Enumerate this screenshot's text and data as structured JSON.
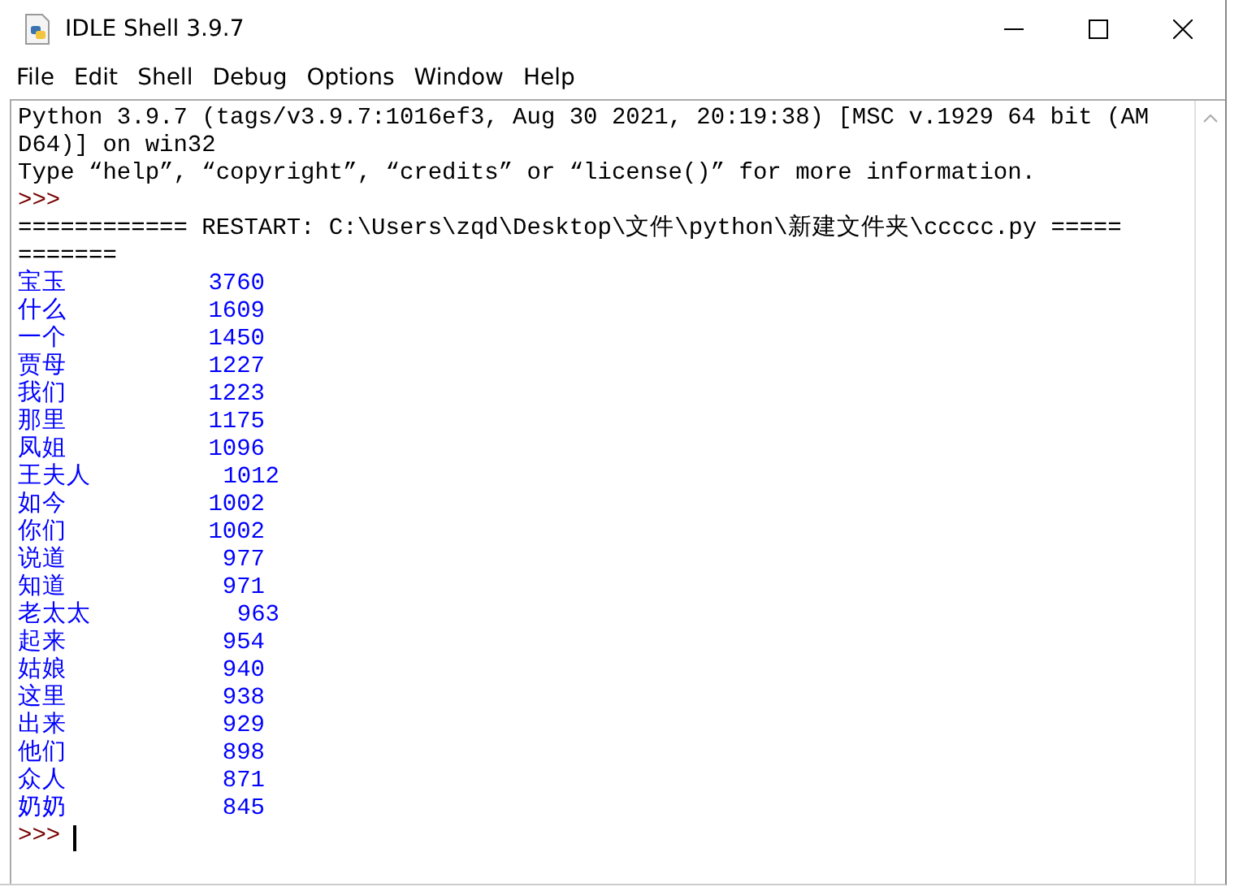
{
  "window": {
    "title": "IDLE Shell 3.9.7"
  },
  "menu": [
    "File",
    "Edit",
    "Shell",
    "Debug",
    "Options",
    "Window",
    "Help"
  ],
  "shell": {
    "lines": [
      {
        "kind": "text",
        "text": "Python 3.9.7 (tags/v3.9.7:1016ef3, Aug 30 2021, 20:19:38) [MSC v.1929 64 bit (AM"
      },
      {
        "kind": "text",
        "text": "D64)] on win32"
      },
      {
        "kind": "text",
        "text": "Type “help”, “copyright”, “credits” or “license()” for more information."
      },
      {
        "kind": "prompt",
        "text": ">>>"
      },
      {
        "kind": "text",
        "text": "============ RESTART: C:\\Users\\zqd\\Desktop\\文件\\python\\新建文件夹\\ccccc.py ====="
      },
      {
        "kind": "text",
        "text": "======="
      },
      {
        "kind": "output",
        "word": "宝玉",
        "count": "3760"
      },
      {
        "kind": "output",
        "word": "什么",
        "count": "1609"
      },
      {
        "kind": "output",
        "word": "一个",
        "count": "1450"
      },
      {
        "kind": "output",
        "word": "贾母",
        "count": "1227"
      },
      {
        "kind": "output",
        "word": "我们",
        "count": "1223"
      },
      {
        "kind": "output",
        "word": "那里",
        "count": "1175"
      },
      {
        "kind": "output",
        "word": "凤姐",
        "count": "1096"
      },
      {
        "kind": "output",
        "word": "王夫人",
        "count": "1012"
      },
      {
        "kind": "output",
        "word": "如今",
        "count": "1002"
      },
      {
        "kind": "output",
        "word": "你们",
        "count": "1002"
      },
      {
        "kind": "output",
        "word": "说道",
        "count": "977"
      },
      {
        "kind": "output",
        "word": "知道",
        "count": "971"
      },
      {
        "kind": "output",
        "word": "老太太",
        "count": "963"
      },
      {
        "kind": "output",
        "word": "起来",
        "count": "954"
      },
      {
        "kind": "output",
        "word": "姑娘",
        "count": "940"
      },
      {
        "kind": "output",
        "word": "这里",
        "count": "938"
      },
      {
        "kind": "output",
        "word": "出来",
        "count": "929"
      },
      {
        "kind": "output",
        "word": "他们",
        "count": "898"
      },
      {
        "kind": "output",
        "word": "众人",
        "count": "871"
      },
      {
        "kind": "output",
        "word": "奶奶",
        "count": "845"
      },
      {
        "kind": "input",
        "text": ">>>"
      }
    ]
  }
}
